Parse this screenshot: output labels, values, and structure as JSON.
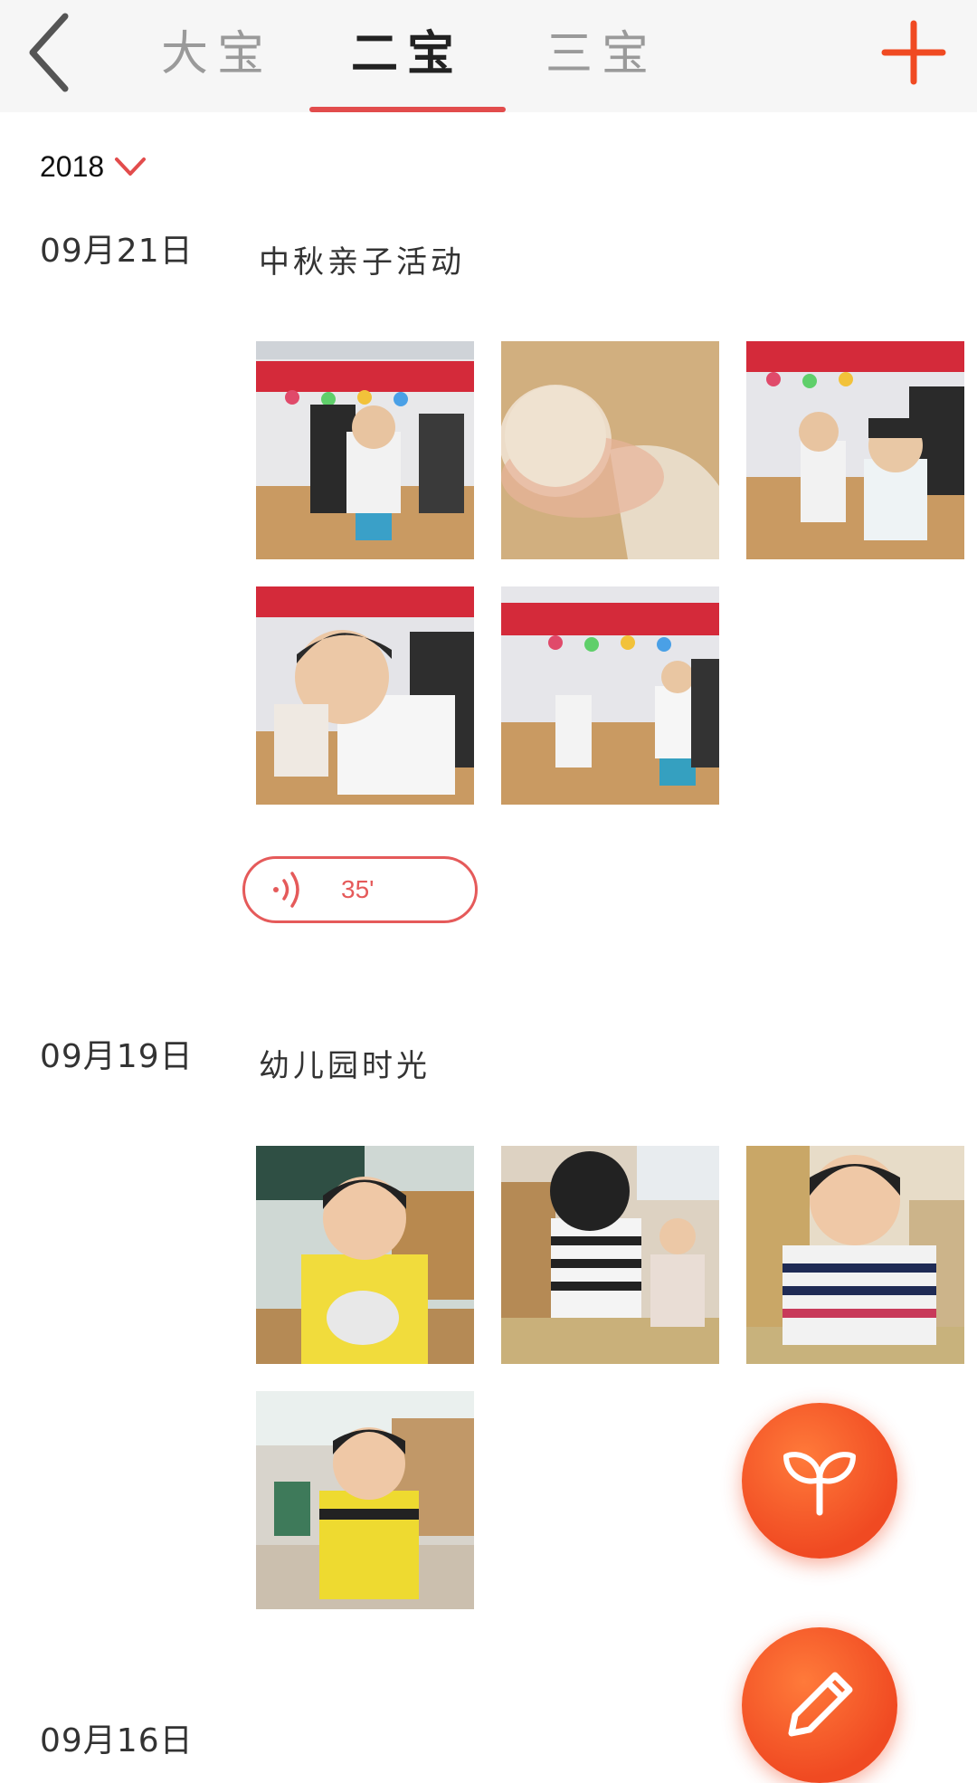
{
  "header": {
    "tabs": [
      {
        "label": "大宝",
        "active": false
      },
      {
        "label": "二宝",
        "active": true
      },
      {
        "label": "三宝",
        "active": false
      }
    ],
    "back_icon": "chevron-left-icon",
    "add_icon": "plus-icon"
  },
  "year_filter": {
    "value": "2018",
    "icon": "chevron-down-icon"
  },
  "entries": [
    {
      "date": "09月21日",
      "title": "中秋亲子活动",
      "photo_count": 5,
      "audio": {
        "duration": "35'",
        "icon": "sound-wave-icon"
      }
    },
    {
      "date": "09月19日",
      "title": "幼儿园时光",
      "photo_count": 4
    },
    {
      "date": "09月16日",
      "title": ""
    }
  ],
  "fabs": {
    "sprout_icon": "sprout-icon",
    "edit_icon": "pencil-icon"
  },
  "colors": {
    "accent": "#e24c4c",
    "fab": "#f04a22",
    "tab_inactive": "#9a9a9a"
  }
}
